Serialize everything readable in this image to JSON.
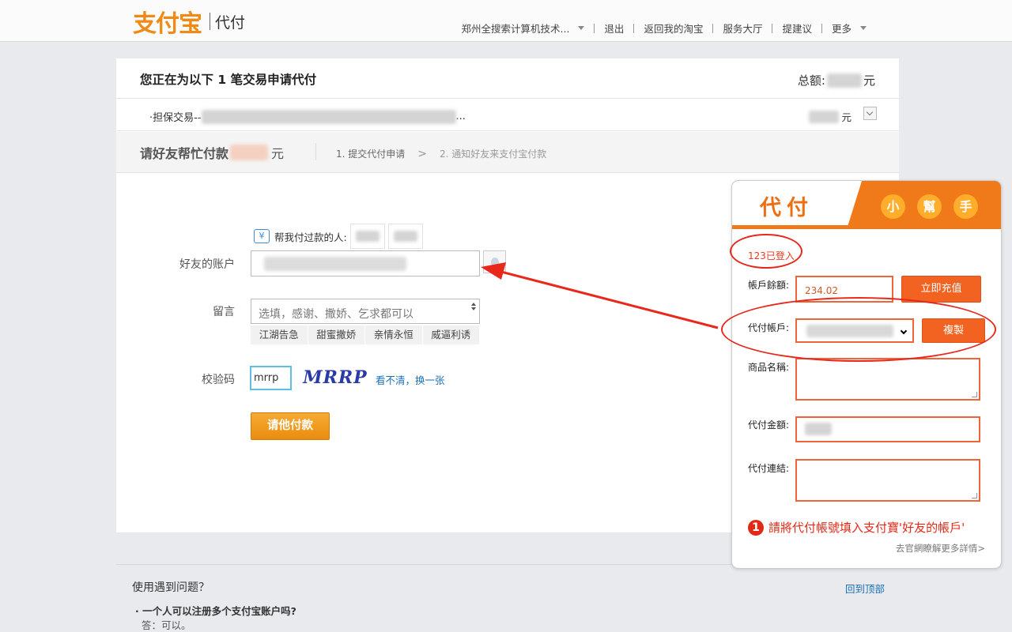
{
  "header": {
    "logo_text": "支付宝",
    "logo_sub": "代付",
    "nav": [
      "郑州全搜索计算机技术...",
      "退出",
      "返回我的淘宝",
      "服务大厅",
      "提建议",
      "更多"
    ]
  },
  "summary": {
    "title": "您正在为以下 1 笔交易申请代付",
    "total_label": "总额:",
    "total_unit": "元",
    "tx_prefix": "·担保交易--",
    "tx_suffix": "...",
    "tx_unit": "元"
  },
  "request": {
    "heading": "请好友帮忙付款",
    "unit": "元",
    "step1": "1. 提交代付申请",
    "arrow": ">",
    "step2": "2. 通知好友来支付宝付款"
  },
  "form": {
    "past_payers_label": "帮我付过款的人:",
    "yen_icon_text": "¥",
    "friend_label": "好友的账户",
    "message_label": "留言",
    "message_placeholder": "选填，感谢、撒娇、乞求都可以",
    "phrases": [
      "江湖告急",
      "甜蜜撒娇",
      "亲情永恒",
      "威逼利诱"
    ],
    "captcha_label": "校验码",
    "captcha_value": "mrrp",
    "captcha_image_text": "MRRP",
    "refresh_text": "看不清，换一张",
    "submit_label": "请他付款"
  },
  "footer": {
    "help_title": "使用遇到问题？",
    "to_top": "回到顶部",
    "faq_q": "· 一个人可以注册多个支付宝账户吗?",
    "faq_a": "答：可以。"
  },
  "helper": {
    "title": "代付",
    "badges": [
      "小",
      "幫",
      "手"
    ],
    "login_status": "123已登入",
    "balance_label": "帳戶餘額:",
    "balance_value": "234.02",
    "recharge_label": "立即充值",
    "account_label": "代付帳戶:",
    "copy_label": "複製",
    "goods_label": "商品名稱:",
    "amount_label": "代付金額:",
    "link_label": "代付連結:",
    "tip_number": "1",
    "tip_text": "請將代付帳號填入支付寶'好友的帳戶'",
    "more_text": "去官網瞭解更多詳情>"
  },
  "colors": {
    "accent_orange": "#f07a1a",
    "annotation_red": "#e8281a",
    "link_blue": "#1a6fb5",
    "submit_orange": "#f0a020"
  }
}
